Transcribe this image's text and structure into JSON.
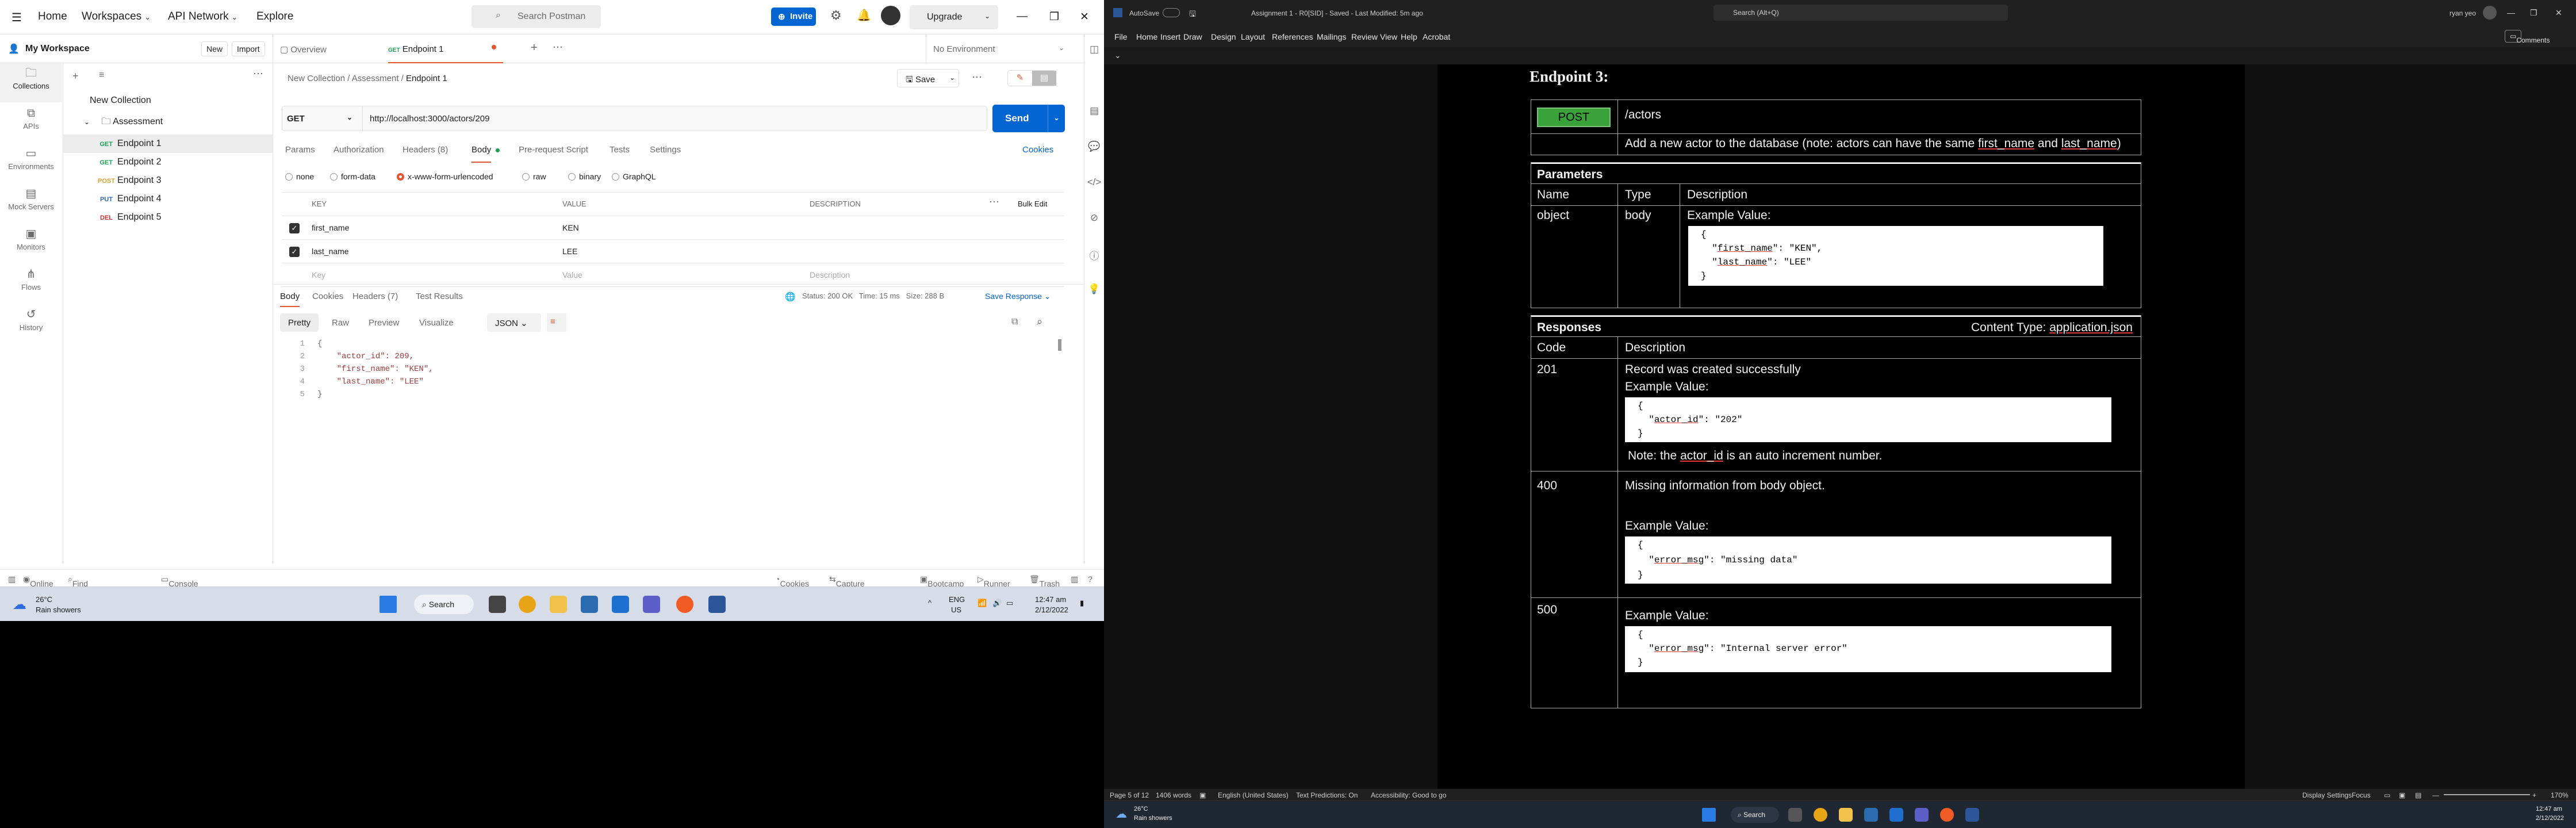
{
  "postman": {
    "topbar": {
      "home": "Home",
      "workspaces": "Workspaces",
      "api_network": "API Network",
      "explore": "Explore",
      "search_placeholder": "Search Postman",
      "invite": "Invite",
      "upgrade": "Upgrade"
    },
    "workspace": {
      "name": "My Workspace",
      "new": "New",
      "import": "Import"
    },
    "rail": [
      "Collections",
      "APIs",
      "Environments",
      "Mock Servers",
      "Monitors",
      "Flows",
      "History"
    ],
    "tree": {
      "collection": "New Collection",
      "folder": "Assessment",
      "items": [
        {
          "method": "GET",
          "name": "Endpoint 1",
          "color": "#1f9d55"
        },
        {
          "method": "GET",
          "name": "Endpoint 2",
          "color": "#1f9d55"
        },
        {
          "method": "POST",
          "name": "Endpoint 3",
          "color": "#d69e2e"
        },
        {
          "method": "PUT",
          "name": "Endpoint 4",
          "color": "#2b6cb0"
        },
        {
          "method": "DEL",
          "name": "Endpoint 5",
          "color": "#c53030"
        }
      ]
    },
    "tabs": {
      "overview": "Overview",
      "active_method": "GET",
      "active": "Endpoint 1",
      "environment": "No Environment"
    },
    "breadcrumb": {
      "collection": "New Collection",
      "folder": "Assessment",
      "request": "Endpoint 1",
      "save": "Save"
    },
    "request": {
      "method": "GET",
      "url": "http://localhost:3000/actors/209",
      "send": "Send",
      "subtabs": [
        "Params",
        "Authorization",
        "Headers (8)",
        "Body",
        "Pre-request Script",
        "Tests",
        "Settings"
      ],
      "cookies": "Cookies",
      "body_types": [
        "none",
        "form-data",
        "x-www-form-urlencoded",
        "raw",
        "binary",
        "GraphQL"
      ],
      "table_headers": {
        "key": "KEY",
        "value": "VALUE",
        "description": "DESCRIPTION",
        "bulk": "Bulk Edit"
      },
      "rows": [
        {
          "key": "first_name",
          "value": "KEN"
        },
        {
          "key": "last_name",
          "value": "LEE"
        }
      ],
      "placeholder_row": {
        "key": "Key",
        "value": "Value",
        "description": "Description"
      }
    },
    "response": {
      "tabs": [
        "Body",
        "Cookies",
        "Headers (7)",
        "Test Results"
      ],
      "status": "Status: 200 OK",
      "time": "Time: 15 ms",
      "size": "Size: 288 B",
      "save_response": "Save Response",
      "views": [
        "Pretty",
        "Raw",
        "Preview",
        "Visualize"
      ],
      "format": "JSON",
      "lines": [
        "{",
        "    \"actor_id\": 209,",
        "    \"first_name\": \"KEN\",",
        "    \"last_name\": \"LEE\"",
        "}"
      ]
    },
    "statusbar": {
      "online": "Online",
      "find": "Find and Replace",
      "console": "Console",
      "cookies": "Cookies",
      "capture": "Capture requests",
      "bootcamp": "Bootcamp",
      "runner": "Runner",
      "trash": "Trash"
    }
  },
  "taskbar_left": {
    "weather_temp": "26°C",
    "weather_desc": "Rain showers",
    "search": "Search",
    "lang": "ENG",
    "region": "US",
    "time": "12:47 am",
    "date": "2/12/2022"
  },
  "word": {
    "title": "Assignment 1 - R0[SID] - Saved - Last Modified: 5m ago",
    "autosave": "AutoSave",
    "search": "Search (Alt+Q)",
    "user": "ryan yeo",
    "menu": [
      "File",
      "Home",
      "Insert",
      "Draw",
      "Design",
      "Layout",
      "References",
      "Mailings",
      "Review",
      "View",
      "Help",
      "Acrobat"
    ],
    "comments": "Comments",
    "heading": "Endpoint 3:",
    "method": "POST",
    "path": "/actors",
    "description_pre": "Add a new actor to the database (note: actors can have the same ",
    "description_f1": "first_name",
    "description_mid": " and ",
    "description_f2": "last_name",
    "description_post": ")",
    "params_title": "Parameters",
    "params_headers": [
      "Name",
      "Type",
      "Description"
    ],
    "param": {
      "name": "object",
      "type": "body",
      "example_label": "Example Value:"
    },
    "param_code": [
      "{",
      "  \"first_name\": \"KEN\",",
      "  \"last_name\": \"LEE\"",
      "}"
    ],
    "responses_title": "Responses",
    "content_type": "Content Type: application.json",
    "resp_headers": [
      "Code",
      "Description"
    ],
    "r201": {
      "code": "201",
      "desc": "Record was created successfully",
      "example": "Example Value:",
      "code_lines": [
        "{",
        "  \"actor_id\": \"202\"",
        "}"
      ],
      "note": "Note: the actor_id is an auto increment number."
    },
    "r400": {
      "code": "400",
      "desc": "Missing information from body object.",
      "example": "Example Value:",
      "code_lines": [
        "{",
        "  \"error_msg\": \"missing data\"",
        "}"
      ]
    },
    "r500": {
      "code": "500",
      "example": "Example Value:",
      "code_lines": [
        "{",
        "  \"error_msg\": \"Internal server error\"",
        "}"
      ]
    },
    "status": {
      "page": "Page 5 of 12",
      "words": "1406 words",
      "lang": "English (United States)",
      "predictions": "Text Predictions: On",
      "accessibility": "Accessibility: Good to go",
      "display": "Display Settings",
      "focus": "Focus",
      "zoom": "170%"
    }
  },
  "taskbar_right": {
    "weather_temp": "26°C",
    "weather_desc": "Rain showers",
    "search": "Search",
    "time": "12:47 am",
    "date": "2/12/2022"
  }
}
